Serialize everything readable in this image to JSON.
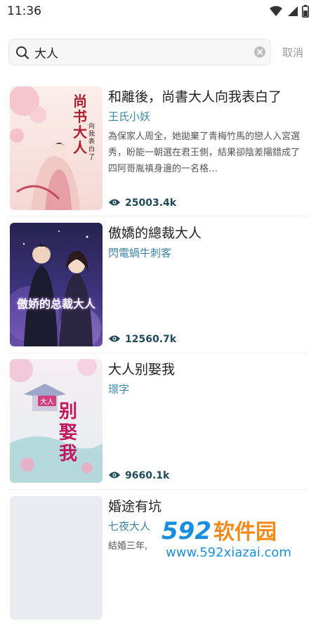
{
  "status_bar": {
    "time": "11:36"
  },
  "search": {
    "query": "大人",
    "cancel_label": "取消"
  },
  "books": [
    {
      "title": "和離後，尚書大人向我表白了",
      "author": "王氏小妖",
      "description": "為保家人周全，她拋棄了青梅竹馬的戀人入宮選秀，盼能一朝選在君王側，結果卻陰差陽錯成了四阿哥胤禛身邊的一名格…",
      "views": "25003.4k",
      "cover_text": "尚书大人",
      "cover_subtext": "向我表白了"
    },
    {
      "title": "傲嬌的總裁大人",
      "author": "閃電蝸牛刺客",
      "description": "",
      "views": "12560.7k",
      "cover_text": "傲娇的总裁大人",
      "cover_subtext": ""
    },
    {
      "title": "大人别娶我",
      "author": "璟字",
      "description": "",
      "views": "9660.1k",
      "cover_text": "别娶我",
      "cover_subtext": "大人"
    },
    {
      "title": "婚途有坑",
      "author": "七夜大人",
      "description": "結婚三年,",
      "views": "",
      "cover_text": "",
      "cover_subtext": ""
    }
  ],
  "watermark": {
    "logo": "592软件园",
    "url": "www.592xiazai.com"
  },
  "colors": {
    "accent": "#3a86a8",
    "views": "#1f4a5c",
    "watermark_blue": "#1a8fe0",
    "watermark_orange": "#f28a1a"
  },
  "icons": [
    "wifi-icon",
    "signal-icon",
    "battery-icon",
    "search-icon",
    "clear-icon",
    "eye-icon"
  ]
}
